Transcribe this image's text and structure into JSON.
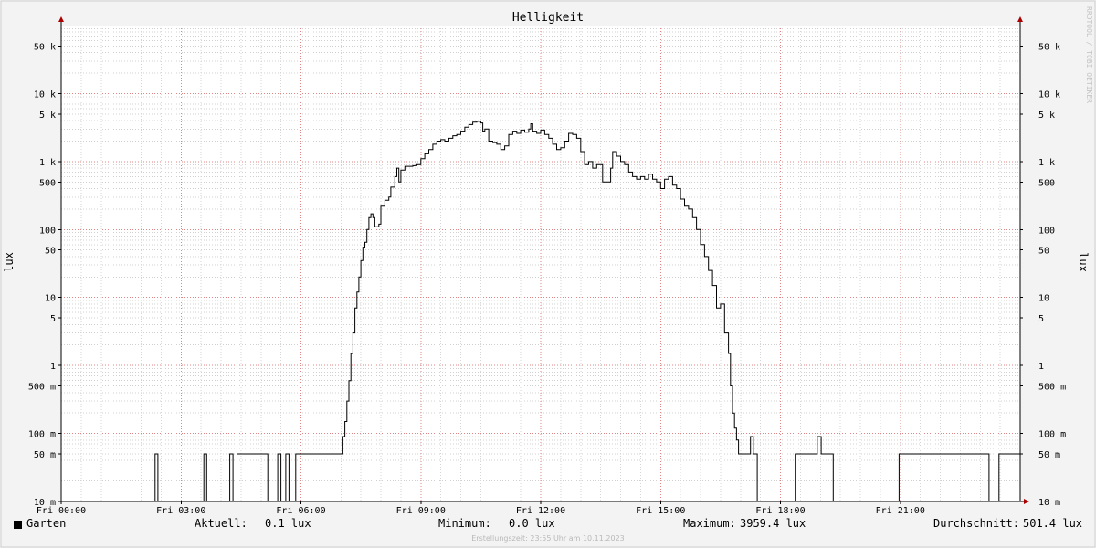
{
  "chart_data": {
    "type": "line",
    "title": "Helligkeit",
    "ylabel": "lux",
    "ylabel_right": "lux",
    "y_scale": "log",
    "ylim": [
      0.01,
      100000
    ],
    "y_ticks": [
      {
        "value": 0.01,
        "label": "10 m"
      },
      {
        "value": 0.05,
        "label": "50 m"
      },
      {
        "value": 0.1,
        "label": "100 m"
      },
      {
        "value": 0.5,
        "label": "500 m"
      },
      {
        "value": 1,
        "label": "1"
      },
      {
        "value": 5,
        "label": "5"
      },
      {
        "value": 10,
        "label": "10"
      },
      {
        "value": 50,
        "label": "50"
      },
      {
        "value": 100,
        "label": "100"
      },
      {
        "value": 500,
        "label": "500"
      },
      {
        "value": 1000,
        "label": "1 k"
      },
      {
        "value": 5000,
        "label": "5 k"
      },
      {
        "value": 10000,
        "label": "10 k"
      },
      {
        "value": 50000,
        "label": "50 k"
      }
    ],
    "x_unit": "hours",
    "xlim": [
      0,
      24
    ],
    "x_ticks": [
      {
        "value": 0,
        "label": "Fri 00:00"
      },
      {
        "value": 3,
        "label": "Fri 03:00"
      },
      {
        "value": 6,
        "label": "Fri 06:00"
      },
      {
        "value": 9,
        "label": "Fri 09:00"
      },
      {
        "value": 12,
        "label": "Fri 12:00"
      },
      {
        "value": 15,
        "label": "Fri 15:00"
      },
      {
        "value": 18,
        "label": "Fri 18:00"
      },
      {
        "value": 21,
        "label": "Fri 21:00"
      }
    ],
    "grid": true,
    "series": [
      {
        "name": "Garten",
        "color": "#000000",
        "points": [
          [
            0.0,
            0.01
          ],
          [
            2.33,
            0.01
          ],
          [
            2.35,
            0.05
          ],
          [
            2.4,
            0.05
          ],
          [
            2.42,
            0.01
          ],
          [
            3.55,
            0.01
          ],
          [
            3.57,
            0.05
          ],
          [
            3.62,
            0.05
          ],
          [
            3.64,
            0.01
          ],
          [
            4.2,
            0.01
          ],
          [
            4.22,
            0.05
          ],
          [
            4.28,
            0.05
          ],
          [
            4.3,
            0.01
          ],
          [
            4.38,
            0.01
          ],
          [
            4.4,
            0.05
          ],
          [
            5.15,
            0.05
          ],
          [
            5.17,
            0.01
          ],
          [
            5.4,
            0.01
          ],
          [
            5.42,
            0.05
          ],
          [
            5.48,
            0.05
          ],
          [
            5.5,
            0.01
          ],
          [
            5.6,
            0.01
          ],
          [
            5.62,
            0.05
          ],
          [
            5.68,
            0.05
          ],
          [
            5.7,
            0.01
          ],
          [
            5.85,
            0.01
          ],
          [
            5.87,
            0.05
          ],
          [
            7.0,
            0.05
          ],
          [
            7.05,
            0.09
          ],
          [
            7.1,
            0.15
          ],
          [
            7.15,
            0.3
          ],
          [
            7.2,
            0.6
          ],
          [
            7.25,
            1.5
          ],
          [
            7.3,
            3
          ],
          [
            7.35,
            7
          ],
          [
            7.4,
            12
          ],
          [
            7.45,
            20
          ],
          [
            7.5,
            35
          ],
          [
            7.55,
            55
          ],
          [
            7.6,
            65
          ],
          [
            7.65,
            100
          ],
          [
            7.7,
            150
          ],
          [
            7.75,
            170
          ],
          [
            7.8,
            150
          ],
          [
            7.85,
            110
          ],
          [
            7.95,
            120
          ],
          [
            8.0,
            220
          ],
          [
            8.1,
            270
          ],
          [
            8.2,
            300
          ],
          [
            8.25,
            420
          ],
          [
            8.35,
            600
          ],
          [
            8.4,
            800
          ],
          [
            8.45,
            500
          ],
          [
            8.5,
            750
          ],
          [
            8.6,
            850
          ],
          [
            8.8,
            870
          ],
          [
            8.9,
            900
          ],
          [
            9.0,
            1100
          ],
          [
            9.1,
            1300
          ],
          [
            9.2,
            1500
          ],
          [
            9.3,
            1800
          ],
          [
            9.4,
            2000
          ],
          [
            9.5,
            2100
          ],
          [
            9.6,
            2000
          ],
          [
            9.7,
            2200
          ],
          [
            9.8,
            2400
          ],
          [
            9.9,
            2500
          ],
          [
            10.0,
            2800
          ],
          [
            10.1,
            3200
          ],
          [
            10.2,
            3500
          ],
          [
            10.3,
            3800
          ],
          [
            10.4,
            3900
          ],
          [
            10.5,
            3700
          ],
          [
            10.55,
            2800
          ],
          [
            10.6,
            3000
          ],
          [
            10.7,
            2000
          ],
          [
            10.8,
            1900
          ],
          [
            10.9,
            1800
          ],
          [
            11.0,
            1500
          ],
          [
            11.1,
            1700
          ],
          [
            11.2,
            2500
          ],
          [
            11.3,
            2800
          ],
          [
            11.4,
            2600
          ],
          [
            11.5,
            2900
          ],
          [
            11.6,
            2700
          ],
          [
            11.7,
            3000
          ],
          [
            11.75,
            3600
          ],
          [
            11.8,
            2800
          ],
          [
            11.9,
            2600
          ],
          [
            12.0,
            2900
          ],
          [
            12.1,
            2500
          ],
          [
            12.2,
            2200
          ],
          [
            12.3,
            1800
          ],
          [
            12.4,
            1500
          ],
          [
            12.5,
            1600
          ],
          [
            12.6,
            2000
          ],
          [
            12.7,
            2600
          ],
          [
            12.8,
            2500
          ],
          [
            12.9,
            2200
          ],
          [
            13.0,
            1400
          ],
          [
            13.1,
            900
          ],
          [
            13.2,
            1000
          ],
          [
            13.3,
            800
          ],
          [
            13.4,
            900
          ],
          [
            13.5,
            900
          ],
          [
            13.55,
            500
          ],
          [
            13.7,
            500
          ],
          [
            13.75,
            800
          ],
          [
            13.8,
            1400
          ],
          [
            13.9,
            1200
          ],
          [
            14.0,
            1000
          ],
          [
            14.1,
            900
          ],
          [
            14.2,
            700
          ],
          [
            14.3,
            600
          ],
          [
            14.4,
            550
          ],
          [
            14.5,
            600
          ],
          [
            14.6,
            550
          ],
          [
            14.7,
            650
          ],
          [
            14.8,
            550
          ],
          [
            14.9,
            500
          ],
          [
            15.0,
            400
          ],
          [
            15.1,
            550
          ],
          [
            15.2,
            600
          ],
          [
            15.3,
            450
          ],
          [
            15.4,
            400
          ],
          [
            15.5,
            280
          ],
          [
            15.6,
            220
          ],
          [
            15.7,
            200
          ],
          [
            15.8,
            150
          ],
          [
            15.9,
            100
          ],
          [
            16.0,
            60
          ],
          [
            16.1,
            40
          ],
          [
            16.2,
            25
          ],
          [
            16.3,
            15
          ],
          [
            16.4,
            7
          ],
          [
            16.5,
            8
          ],
          [
            16.6,
            3
          ],
          [
            16.7,
            1.5
          ],
          [
            16.75,
            0.5
          ],
          [
            16.8,
            0.2
          ],
          [
            16.85,
            0.12
          ],
          [
            16.9,
            0.08
          ],
          [
            16.95,
            0.05
          ],
          [
            17.2,
            0.05
          ],
          [
            17.25,
            0.09
          ],
          [
            17.3,
            0.09
          ],
          [
            17.32,
            0.05
          ],
          [
            17.4,
            0.05
          ],
          [
            17.42,
            0.01
          ],
          [
            18.35,
            0.01
          ],
          [
            18.37,
            0.05
          ],
          [
            18.9,
            0.05
          ],
          [
            18.92,
            0.09
          ],
          [
            19.0,
            0.09
          ],
          [
            19.02,
            0.05
          ],
          [
            19.3,
            0.05
          ],
          [
            19.32,
            0.01
          ],
          [
            20.95,
            0.01
          ],
          [
            20.97,
            0.05
          ],
          [
            23.2,
            0.05
          ],
          [
            23.22,
            0.01
          ],
          [
            23.45,
            0.01
          ],
          [
            23.47,
            0.05
          ],
          [
            24.0,
            0.05
          ]
        ]
      }
    ]
  },
  "legend": {
    "series_name": "Garten",
    "current_label": "Aktuell:",
    "current_value": "0.1 lux",
    "min_label": "Minimum:",
    "min_value": "0.0 lux",
    "max_label": "Maximum:",
    "max_value": "3959.4 lux",
    "avg_label": "Durchschnitt:",
    "avg_value": "501.4 lux"
  },
  "watermark": "RRDTOOL / TOBI OETIKER",
  "footer": "Erstellungszeit: 23:55 Uhr am 10.11.2023"
}
